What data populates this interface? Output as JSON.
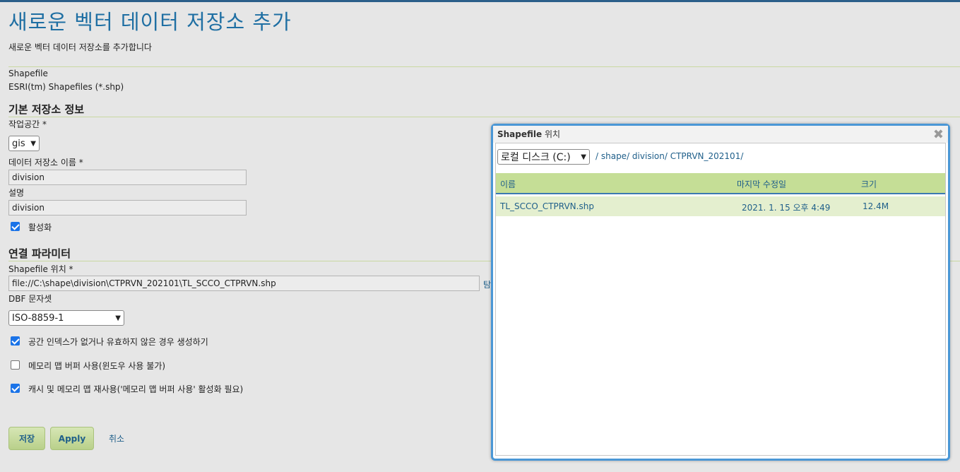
{
  "page": {
    "title": "새로운 벡터 데이터 저장소 추가",
    "subtitle": "새로운 벡터 데이터 저장소를 추가합니다",
    "store_type": "Shapefile",
    "store_desc": "ESRI(tm) Shapefiles (*.shp)"
  },
  "basic": {
    "section_title": "기본 저장소 정보",
    "workspace_label": "작업공간 *",
    "workspace_value": "gis",
    "name_label": "데이터 저장소 이름 *",
    "name_value": "division",
    "desc_label": "설명",
    "desc_value": "division",
    "enabled_label": "활성화",
    "enabled_checked": true
  },
  "params": {
    "section_title": "연결 파라미터",
    "location_label": "Shapefile 위치 *",
    "location_value": "file://C:\\shape\\division\\CTPRVN_202101\\TL_SCCO_CTPRVN.shp",
    "browse_label": "탐",
    "charset_label": "DBF 문자셋",
    "charset_value": "ISO-8859-1",
    "opt_spatial_index": "공간 인덱스가 없거나 유효하지 않은 경우 생성하기",
    "opt_memory_map": "메모리 맵 버퍼 사용(윈도우 사용 불가)",
    "opt_cache": "캐시 및 메모리 맵 재사용('메모리 맵 버퍼 사용' 활성화 필요)"
  },
  "actions": {
    "save": "저장",
    "apply": "Apply",
    "cancel": "취소"
  },
  "dialog": {
    "title_bold": "Shapefile",
    "title_rest": " 위치",
    "drive": "로컬 디스크 (C:)",
    "path": "/ shape/ division/ CTPRVN_202101/",
    "col_name": "이름",
    "col_modified": "마지막 수정일",
    "col_size": "크기",
    "files": [
      {
        "name": "TL_SCCO_CTPRVN.shp",
        "modified": "2021. 1. 15 오후 4:49",
        "size": "12.4M"
      }
    ]
  },
  "colors": {
    "accent": "#1f6fa3",
    "button_green": "#c5de96",
    "dialog_border": "#4a97d6"
  }
}
